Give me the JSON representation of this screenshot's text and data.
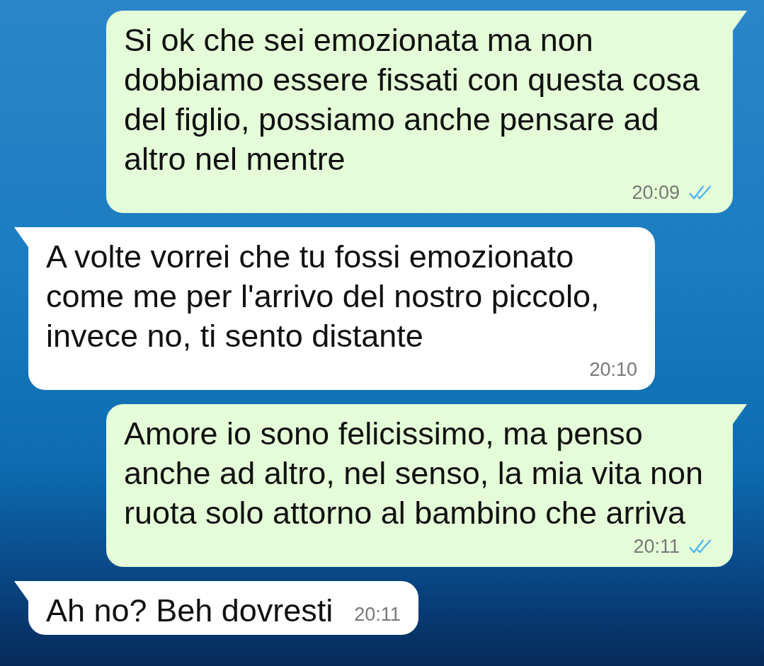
{
  "messages": [
    {
      "kind": "outgoing",
      "text": "Si ok che sei emozionata ma non dobbiamo essere fissati con questa cosa del figlio, possiamo anche pensare ad altro nel mentre",
      "time": "20:09",
      "read": true
    },
    {
      "kind": "incoming",
      "text": "A volte vorrei che tu fossi emozionato come me per l'arrivo del nostro piccolo, invece no, ti sento distante",
      "time": "20:10"
    },
    {
      "kind": "outgoing",
      "text": "Amore io sono felicissimo, ma penso anche ad altro, nel senso, la mia vita non ruota solo attorno al bambino che arriva",
      "time": "20:11",
      "read": true
    },
    {
      "kind": "incoming",
      "text": "Ah no? Beh dovresti",
      "time": "20:11"
    }
  ]
}
